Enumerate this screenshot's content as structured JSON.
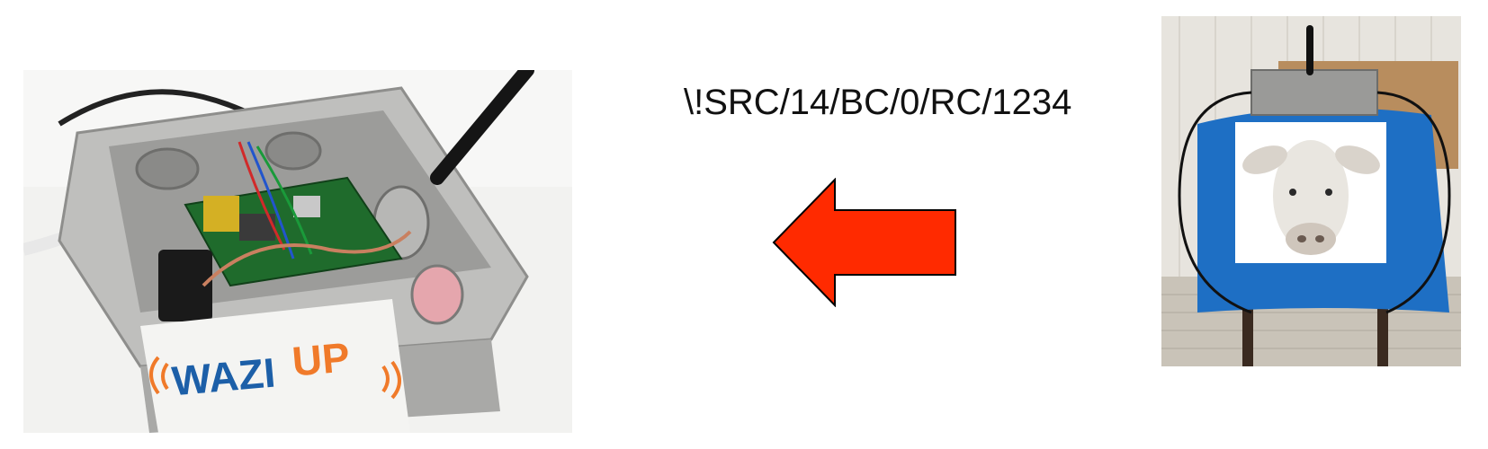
{
  "message": {
    "text": "\\!SRC/14/BC/0/RC/1234"
  },
  "logo": {
    "text_left": "WAZI",
    "text_right": "UP"
  },
  "colors": {
    "arrow_fill": "#ff2a00",
    "arrow_stroke": "#000000",
    "logo_blue": "#1c5fa8",
    "logo_orange": "#f07a2a"
  },
  "icons": {
    "arrow": "left-arrow-icon",
    "antenna": "antenna-icon"
  }
}
